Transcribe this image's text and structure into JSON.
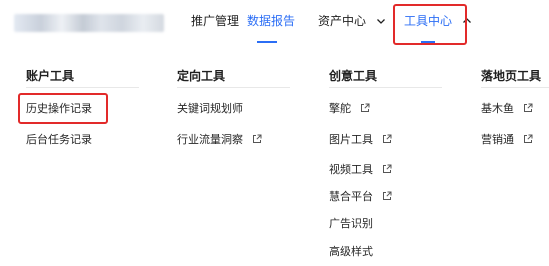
{
  "nav": {
    "items": [
      {
        "label": "推广管理"
      },
      {
        "label": "数据报告"
      },
      {
        "label": "资产中心"
      },
      {
        "label": "工具中心"
      }
    ]
  },
  "menu": {
    "columns": [
      {
        "title": "账户工具",
        "items": [
          "历史操作记录",
          "后台任务记录"
        ]
      },
      {
        "title": "定向工具",
        "items": [
          "关键词规划师",
          "行业流量洞察"
        ]
      },
      {
        "title": "创意工具",
        "items": [
          "擎舵",
          "图片工具",
          "视频工具",
          "慧合平台",
          "广告识别",
          "高级样式"
        ]
      },
      {
        "title": "落地页工具",
        "items": [
          "基木鱼",
          "营销通"
        ]
      }
    ]
  },
  "colors": {
    "accent": "#2b6ef5",
    "highlight": "#e22a2a"
  }
}
